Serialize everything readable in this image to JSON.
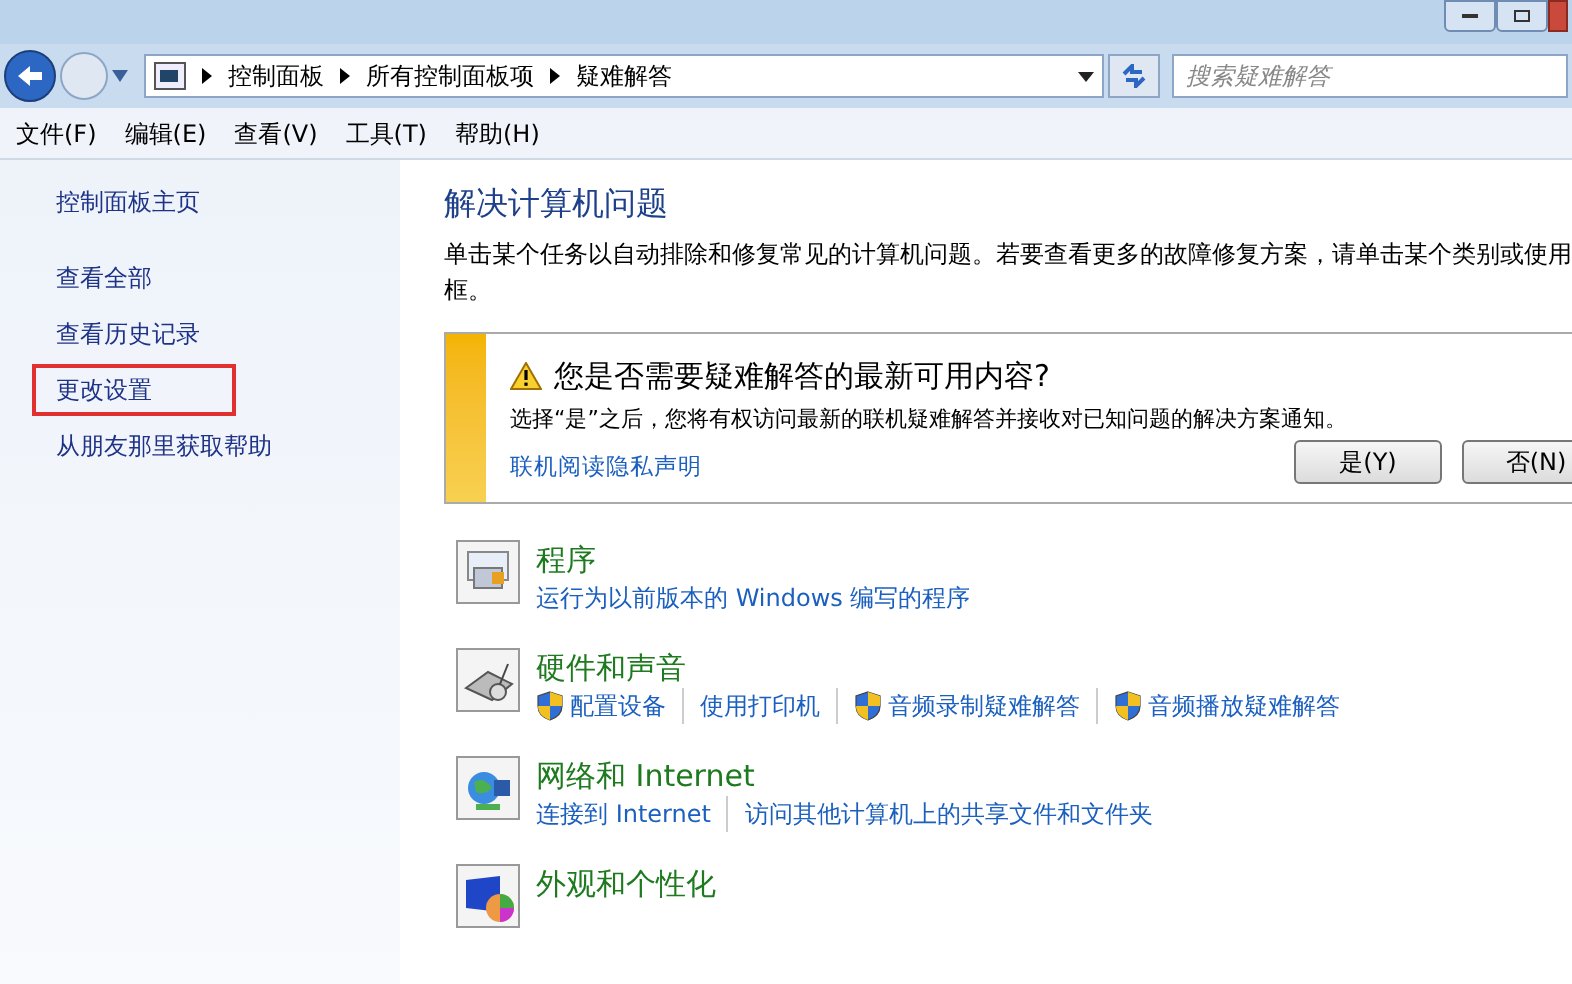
{
  "address_bar": {
    "crumbs": [
      "控制面板",
      "所有控制面板项",
      "疑难解答"
    ]
  },
  "search": {
    "placeholder": "搜索疑难解答"
  },
  "menu_bar": [
    "文件(F)",
    "编辑(E)",
    "查看(V)",
    "工具(T)",
    "帮助(H)"
  ],
  "sidebar": {
    "home": "控制面板主页",
    "items": [
      {
        "label": "查看全部",
        "highlighted": false
      },
      {
        "label": "查看历史记录",
        "highlighted": false
      },
      {
        "label": "更改设置",
        "highlighted": true
      },
      {
        "label": "从朋友那里获取帮助",
        "highlighted": false
      }
    ]
  },
  "main": {
    "title": "解决计算机问题",
    "description": "单击某个任务以自动排除和修复常见的计算机问题。若要查看更多的故障修复方案，请单击某个类别或使用框。",
    "notice": {
      "title": "您是否需要疑难解答的最新可用内容?",
      "text": "选择“是”之后，您将有权访问最新的联机疑难解答并接收对已知问题的解决方案通知。",
      "link": "联机阅读隐私声明",
      "buttons": [
        "是(Y)",
        "否(N)"
      ]
    },
    "categories": [
      {
        "kind": "programs",
        "title": "程序",
        "links": [
          {
            "label": "运行为以前版本的 Windows 编写的程序",
            "shield": false
          }
        ]
      },
      {
        "kind": "hardware",
        "title": "硬件和声音",
        "links": [
          {
            "label": "配置设备",
            "shield": true
          },
          {
            "label": "使用打印机",
            "shield": false
          },
          {
            "label": "音频录制疑难解答",
            "shield": true
          },
          {
            "label": "音频播放疑难解答",
            "shield": true
          }
        ]
      },
      {
        "kind": "network",
        "title": "网络和 Internet",
        "links": [
          {
            "label": "连接到 Internet",
            "shield": false
          },
          {
            "label": "访问其他计算机上的共享文件和文件夹",
            "shield": false
          }
        ]
      },
      {
        "kind": "appearance",
        "title": "外观和个性化"
      }
    ]
  }
}
